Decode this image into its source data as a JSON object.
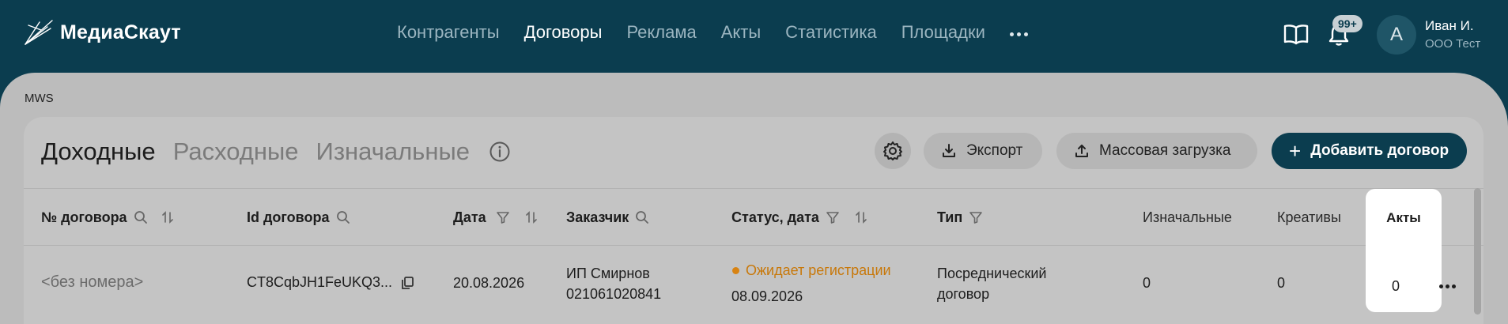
{
  "app": {
    "name": "МедиаСкаут"
  },
  "nav": {
    "items": [
      {
        "label": "Контрагенты",
        "active": false
      },
      {
        "label": "Договоры",
        "active": true
      },
      {
        "label": "Реклама",
        "active": false
      },
      {
        "label": "Акты",
        "active": false
      },
      {
        "label": "Статистика",
        "active": false
      },
      {
        "label": "Площадки",
        "active": false
      }
    ],
    "more_icon": "more-horizontal-icon"
  },
  "header": {
    "notifications_badge": "99+",
    "avatar_letter": "А",
    "user_name": "Иван И.",
    "user_org": "ООО Тест"
  },
  "breadcrumb": "MWS",
  "tabs": [
    {
      "label": "Доходные",
      "active": true
    },
    {
      "label": "Расходные",
      "active": false
    },
    {
      "label": "Изначальные",
      "active": false
    }
  ],
  "toolbar": {
    "export_label": "Экспорт",
    "bulk_label": "Массовая загрузка",
    "add_label": "Добавить договор"
  },
  "table": {
    "columns": {
      "number": "№ договора",
      "id": "Id договора",
      "date": "Дата",
      "customer": "Заказчик",
      "status": "Статус, дата",
      "type": "Тип",
      "initial": "Изначальные",
      "creatives": "Креативы",
      "acts": "Акты"
    },
    "rows": [
      {
        "number": "<без номера>",
        "id": "CT8CqbJH1FeUKQ3...",
        "date": "20.08.2026",
        "customer_name": "ИП Смирнов",
        "customer_inn": "021061020841",
        "status": "Ожидает регистрации",
        "status_date": "08.09.2026",
        "type_line1": "Посреднический",
        "type_line2": "договор",
        "initial": "0",
        "creatives": "0",
        "acts": "0"
      }
    ]
  },
  "colors": {
    "brand": "#0b3d4f",
    "status_pending": "#d88312"
  }
}
